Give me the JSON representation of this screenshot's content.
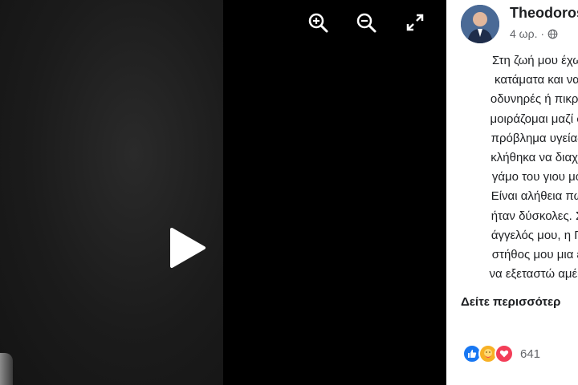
{
  "post": {
    "author": "Theodoros",
    "time": "4 ωρ. ·",
    "privacy_icon": "globe-icon",
    "text_lines": [
      "Στη ζωή μου έχω",
      "κατάματα και να",
      "οδυνηρές ή πικρέ",
      "μοιράζομαι μαζί σ",
      "πρόβλημα υγείας",
      "κλήθηκα να διαχε",
      "γάμο του γιου μο",
      "Είναι αλήθεια πω",
      "ήταν δύσκολες. Σ",
      "άγγελός μου, η Γι",
      "στήθος μου μια έ",
      "να εξεταστώ αμέσ"
    ],
    "see_more": "Δείτε περισσότερ",
    "reaction_icons": [
      "like-icon",
      "care-icon",
      "love-icon"
    ],
    "reaction_count": "641"
  },
  "viewer": {
    "icons": [
      "zoom-in-icon",
      "zoom-out-icon",
      "fullscreen-icon",
      "play-icon"
    ]
  },
  "colors": {
    "facebook_blue": "#1877f2",
    "love_red": "#f33e58",
    "care_yellow": "#f7b125"
  }
}
